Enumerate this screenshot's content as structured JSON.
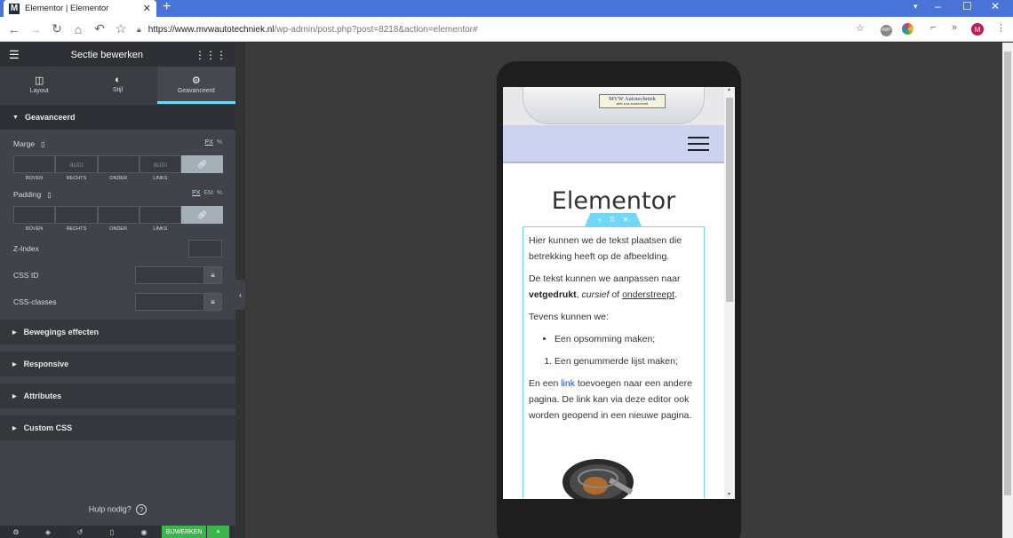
{
  "browser": {
    "tab_title": "Elementor | Elementor",
    "tab_favicon": "M",
    "url_host": "https://www.mvwautotechniek.nl",
    "url_path": "/wp-admin/post.php?post=8218&action=elementor#",
    "profile_initial": "M"
  },
  "panel": {
    "title": "Sectie bewerken",
    "tabs": [
      {
        "label": "Layout",
        "icon": "columns-icon"
      },
      {
        "label": "Stijl",
        "icon": "contrast-icon"
      },
      {
        "label": "Geavanceerd",
        "icon": "gear-icon"
      }
    ],
    "section_title": "Geavanceerd",
    "margin": {
      "label": "Marge",
      "unit_px": "PX",
      "unit_pct": "%",
      "values": [
        "",
        "auto",
        "",
        "auto"
      ],
      "placeholders": [
        "",
        "auto",
        "",
        "auto"
      ],
      "sides": [
        "BOVEN",
        "RECHTS",
        "ONDER",
        "LINKS"
      ]
    },
    "padding": {
      "label": "Padding",
      "unit_px": "PX",
      "unit_em": "EM",
      "unit_pct": "%",
      "sides": [
        "BOVEN",
        "RECHTS",
        "ONDER",
        "LINKS"
      ]
    },
    "zindex_label": "Z-Index",
    "cssid_label": "CSS ID",
    "cssclasses_label": "CSS-classes",
    "collapsed_sections": [
      "Bewegings effecten",
      "Responsive",
      "Attributes",
      "Custom CSS"
    ],
    "help_text": "Hulp nodig?",
    "update_label": "BIJWERKEN"
  },
  "preview": {
    "logo_line1": "MVW Autotechniek",
    "logo_line2": "alles voor autotechniek",
    "page_title": "Elementor",
    "para1": "Hier kunnen we de tekst plaatsen die betrekking heeft op de afbeelding.",
    "para2_prefix": "De tekst kunnen we aanpassen naar",
    "bold_word": "vetgedrukt",
    "sep1": ",",
    "italic_word": "cursief",
    "of_word": "of",
    "underline_word": "onderstreept",
    "para2_suffix": ".",
    "para3": "Tevens kunnen we:",
    "bullet_item": "Een opsomming maken;",
    "numbered_item": "Een genummerde lijst maken;",
    "para4_prefix": "En een",
    "link_word": "link",
    "para4_suffix": "toevoegen naar een andere pagina. De link kan via deze editor ook worden geopend in een nieuwe pagina."
  },
  "colors": {
    "panel_bg": "#404349",
    "accent": "#71d7f7",
    "update_green": "#39b54a",
    "navbar_bg": "#ccd3f0"
  }
}
